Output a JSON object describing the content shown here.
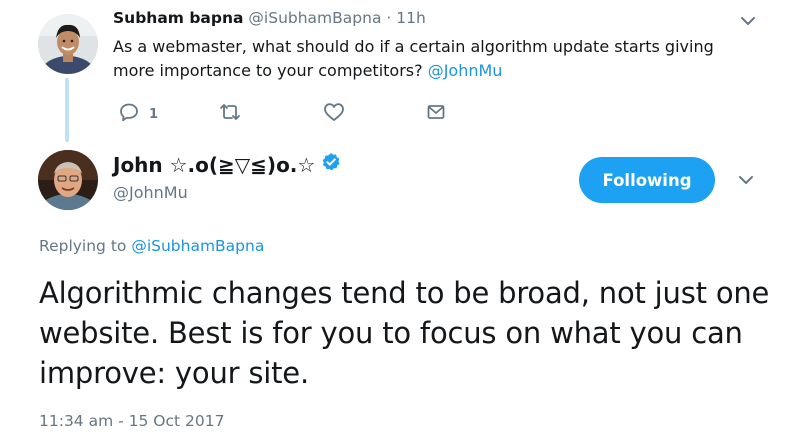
{
  "reply_tweet": {
    "display_name": "Subham bapna",
    "handle": "@iSubhamBapna",
    "separator": " · ",
    "time_ago": "11h",
    "text": "As a webmaster, what should do if a certain algorithm update starts giving more importance to your competitors? ",
    "mention": "@JohnMu",
    "reply_count": "1",
    "icons": [
      "reply-icon",
      "retweet-icon",
      "like-icon",
      "direct-message-icon",
      "chevron-down-icon"
    ]
  },
  "main_tweet": {
    "display_name": "John ☆.o(≧▽≦)o.☆",
    "handle": "@JohnMu",
    "follow_label": "Following",
    "replying_prefix": "Replying to ",
    "replying_to": "@iSubhamBapna",
    "text": "Algorithmic changes tend to be broad, not just one website. Best is for you to focus on what you can improve: your site.",
    "timestamp": "11:34 am - 15 Oct 2017",
    "icons": [
      "verified-badge-icon",
      "chevron-down-icon"
    ]
  },
  "colors": {
    "accent": "#1da1f2",
    "link": "#1b95e0",
    "muted": "#657786",
    "thread_line": "#bfe1f7"
  }
}
